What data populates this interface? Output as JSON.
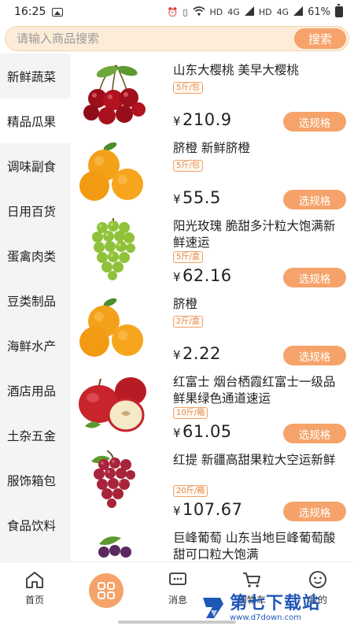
{
  "status_bar": {
    "time": "16:25",
    "net_1": "HD",
    "net_2": "4G",
    "net_3": "HD",
    "net_4": "4G",
    "battery": "61%"
  },
  "search": {
    "placeholder": "请输入商品搜索",
    "button_label": "搜索"
  },
  "sidebar": {
    "items": [
      {
        "label": "新鲜蔬菜"
      },
      {
        "label": "精品瓜果"
      },
      {
        "label": "调味副食"
      },
      {
        "label": "日用百货"
      },
      {
        "label": "蛋禽肉类"
      },
      {
        "label": "豆类制品"
      },
      {
        "label": "海鲜水产"
      },
      {
        "label": "酒店用品"
      },
      {
        "label": "土杂五金"
      },
      {
        "label": "服饰箱包"
      },
      {
        "label": "食品饮料"
      }
    ],
    "active_index": 1
  },
  "products": [
    {
      "name": "山东大樱桃 美早大樱桃",
      "unit": "5斤/包",
      "currency": "¥",
      "price": "210.9",
      "button": "选规格",
      "image": "cherries"
    },
    {
      "name": "脐橙 新鲜脐橙",
      "unit": "5斤/包",
      "currency": "¥",
      "price": "55.5",
      "button": "选规格",
      "image": "oranges"
    },
    {
      "name": "阳光玫瑰 脆甜多汁粒大饱满新鲜速运",
      "unit": "5斤/盒",
      "currency": "¥",
      "price": "62.16",
      "button": "选规格",
      "image": "green-grapes"
    },
    {
      "name": "脐橙",
      "unit": "2斤/盒",
      "currency": "¥",
      "price": "2.22",
      "button": "选规格",
      "image": "oranges"
    },
    {
      "name": "红富士 烟台栖霞红富士一级品鲜果绿色通道速运",
      "unit": "10斤/箱",
      "currency": "¥",
      "price": "61.05",
      "button": "选规格",
      "image": "apples"
    },
    {
      "name": "红提 新疆高甜果粒大空运新鲜",
      "unit": "20斤/箱",
      "currency": "¥",
      "price": "107.67",
      "button": "选规格",
      "image": "red-grapes"
    },
    {
      "name": "巨峰葡萄 山东当地巨峰葡萄酸甜可口粒大饱满",
      "unit": "",
      "currency": "",
      "price": "",
      "button": "",
      "image": "grapes"
    }
  ],
  "bottom_nav": {
    "home": "首页",
    "category": "",
    "messages": "消息",
    "cart": "购物车",
    "mine": "我的"
  },
  "watermark": {
    "main": "第七下载站",
    "sub": "www.d7down.com"
  },
  "colors": {
    "accent": "#f5a36a",
    "search_bg": "#fdecd8",
    "sidebar_bg": "#f4f4f4",
    "watermark": "#1f57b7"
  }
}
